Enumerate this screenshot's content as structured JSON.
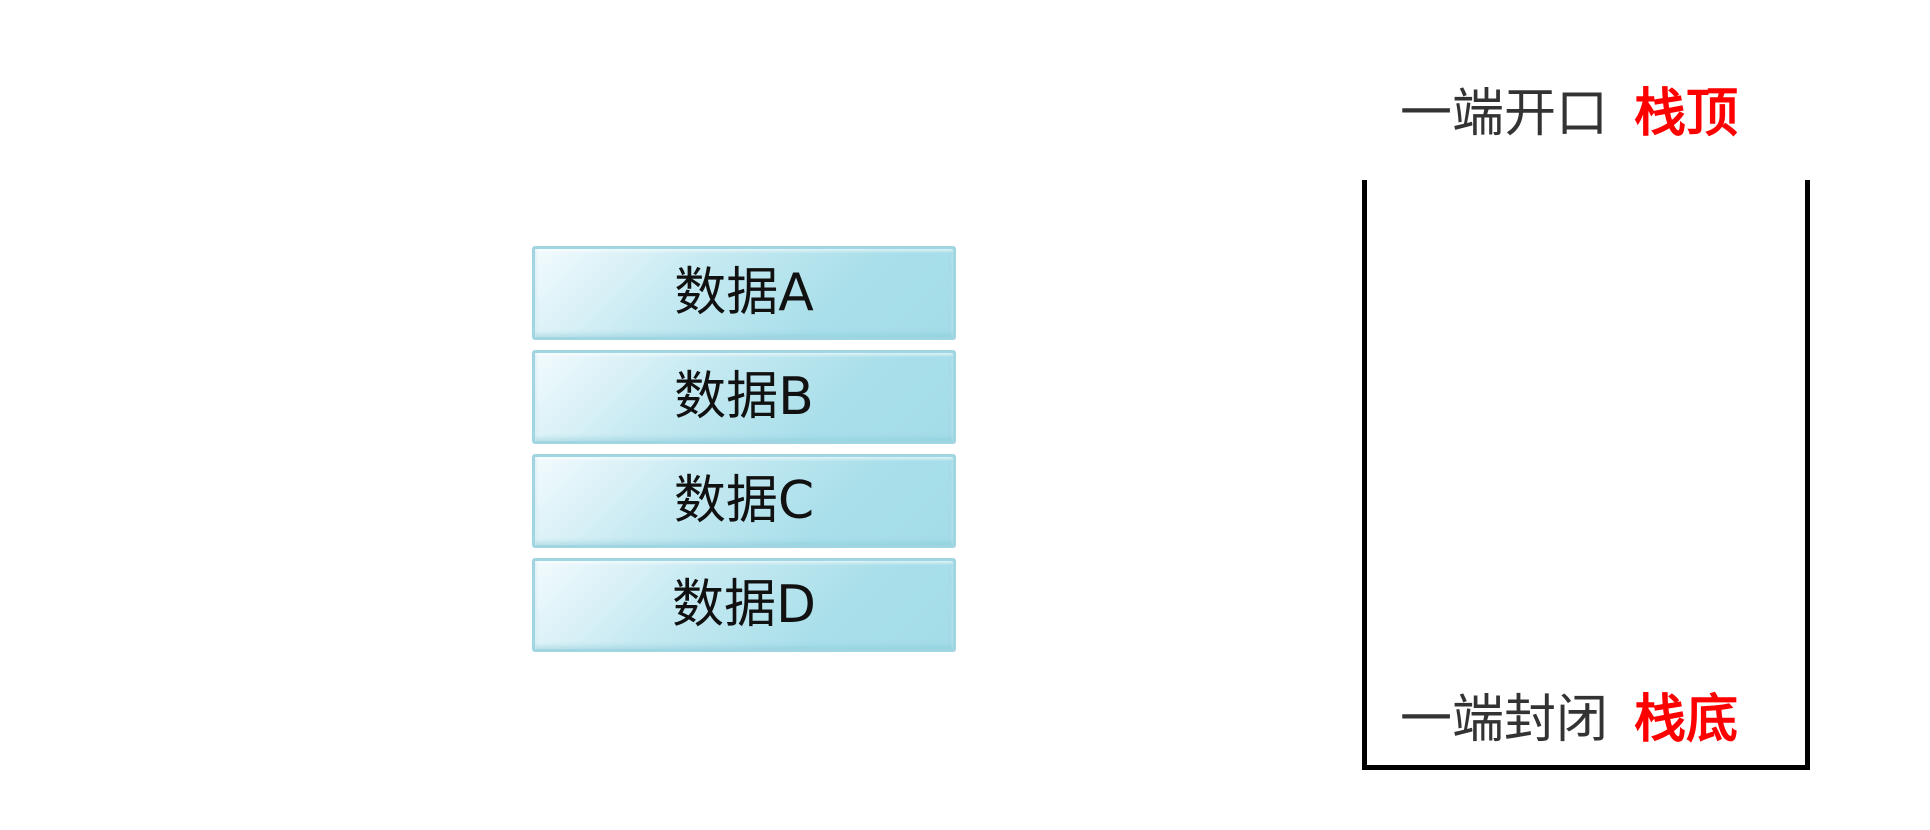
{
  "data_blocks": [
    {
      "label": "数据A"
    },
    {
      "label": "数据B"
    },
    {
      "label": "数据C"
    },
    {
      "label": "数据D"
    }
  ],
  "stack": {
    "top_description": "一端开口",
    "top_term": "栈顶",
    "bottom_description": "一端封闭",
    "bottom_term": "栈底"
  },
  "colors": {
    "block_fill": "#a9dfea",
    "block_border": "#9fd6e2",
    "accent": "#ff0000",
    "container_stroke": "#000000"
  }
}
